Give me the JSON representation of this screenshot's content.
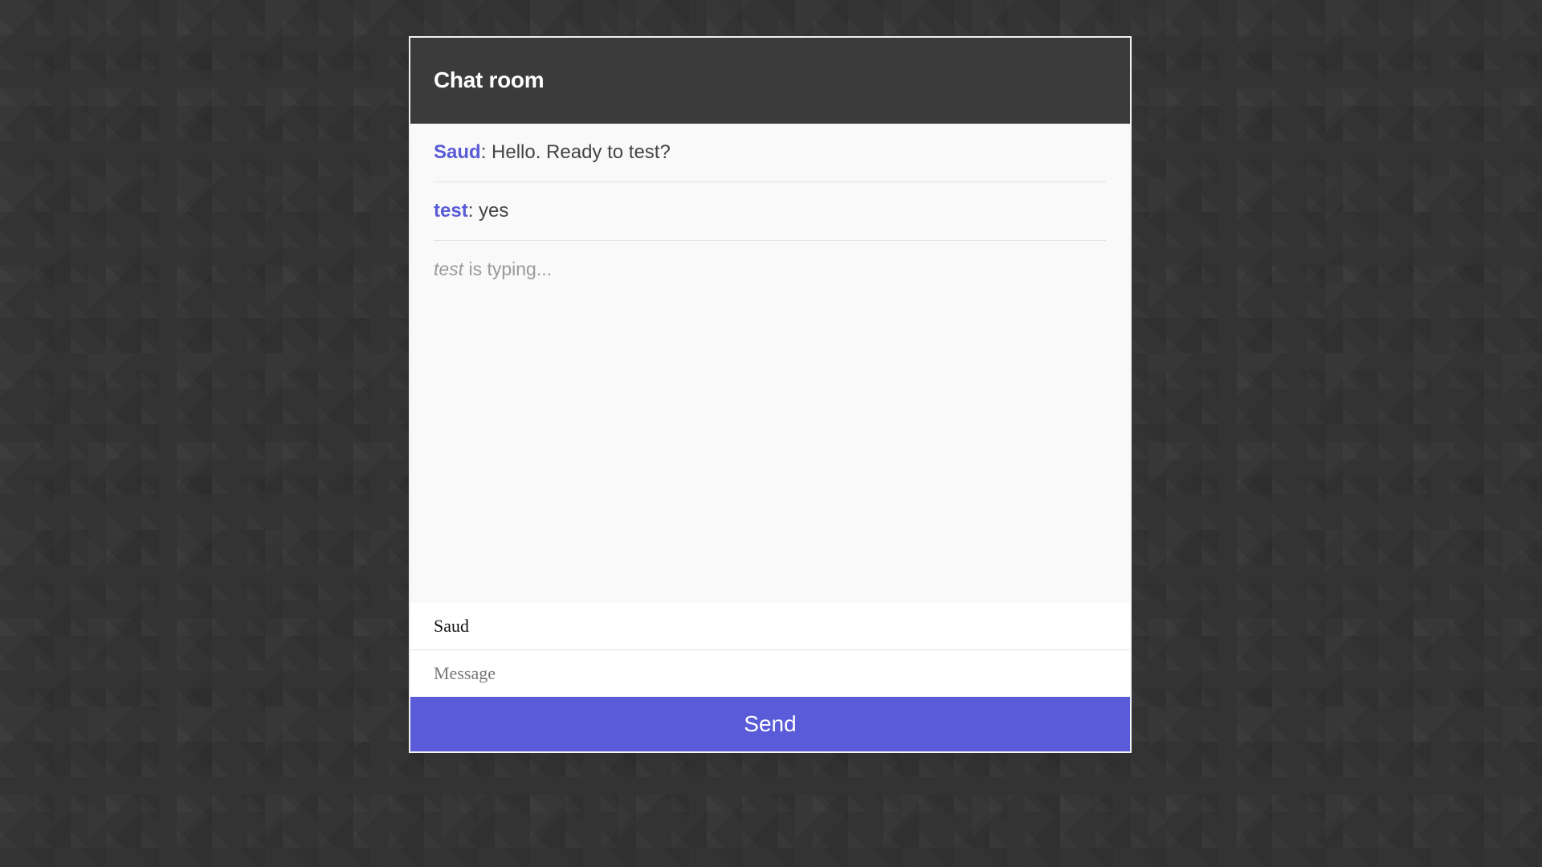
{
  "header": {
    "title": "Chat room"
  },
  "messages": [
    {
      "author": "Saud",
      "separator": ": ",
      "text": "Hello. Ready to test?"
    },
    {
      "author": "test",
      "separator": ": ",
      "text": "yes"
    }
  ],
  "typing": {
    "user": "test",
    "suffix": " is typing..."
  },
  "form": {
    "name_value": "Saud",
    "message_value": "",
    "message_placeholder": "Message",
    "send_label": "Send"
  },
  "colors": {
    "accent": "#5a5bd8",
    "header_bg": "#333333",
    "panel_bg": "#f9f9f9"
  }
}
